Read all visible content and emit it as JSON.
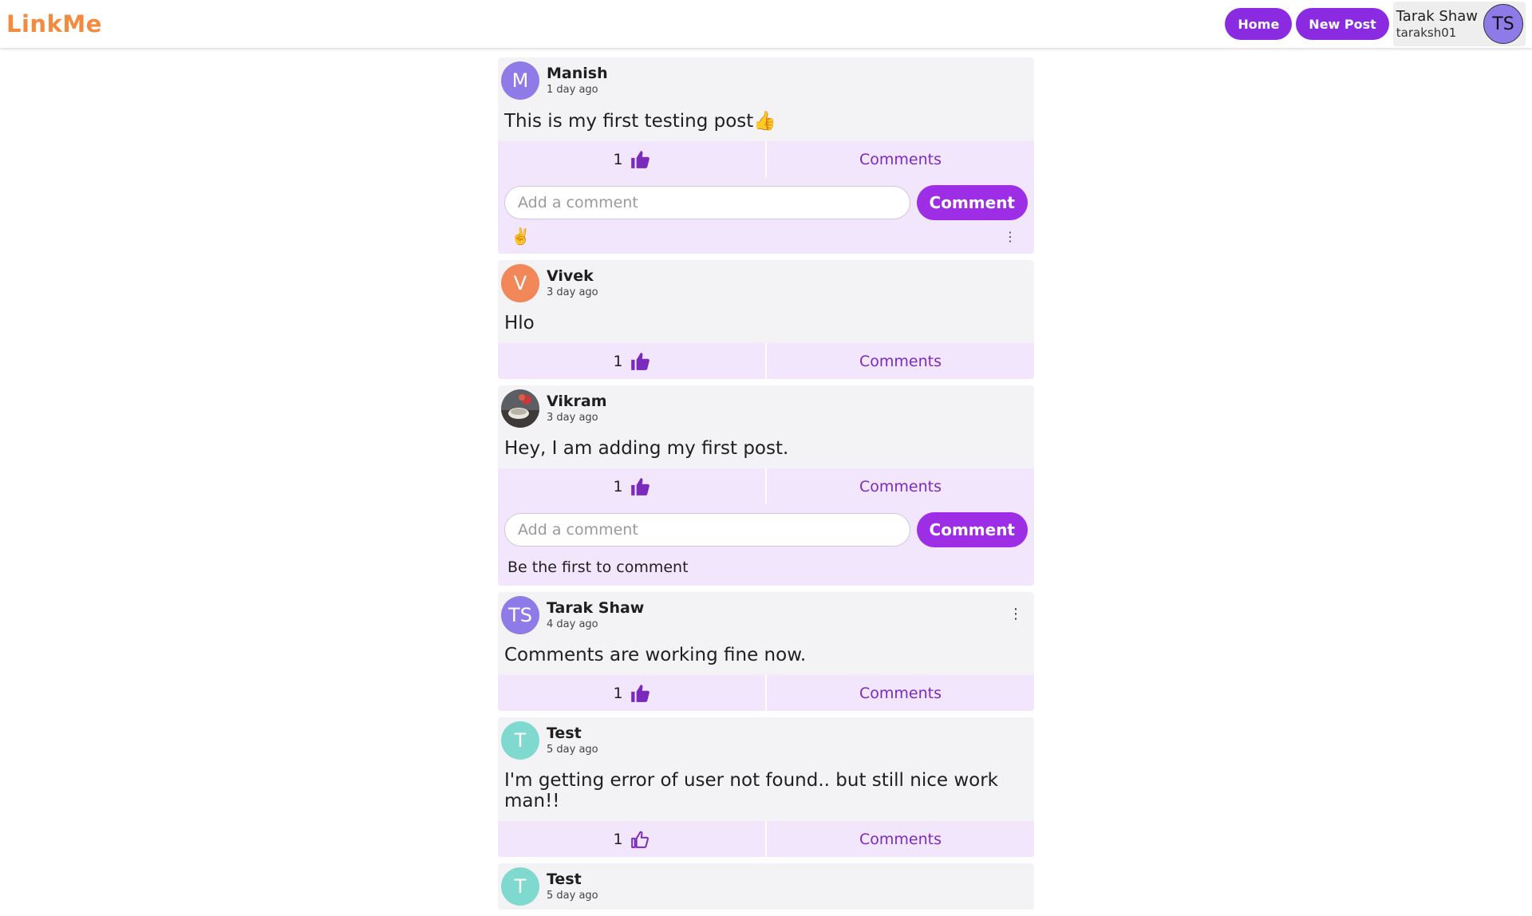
{
  "app": {
    "brand": "LinkMe"
  },
  "nav": {
    "home": "Home",
    "new_post": "New Post",
    "user": {
      "name": "Tarak Shaw",
      "handle": "taraksh01",
      "initials": "TS"
    }
  },
  "colors": {
    "accent": "#8a2be2",
    "brand": "#f28b3f",
    "action_bg": "#f1e6fc"
  },
  "comment_form": {
    "placeholder": "Add a comment",
    "button": "Comment"
  },
  "posts": [
    {
      "author": "Manish",
      "initials": "M",
      "avatar_color": "#8f7be8",
      "time": "1 day ago",
      "text": "This is my first testing post👍",
      "likes": "1",
      "liked": true,
      "comments_label": "Comments",
      "comment_open": true,
      "comments": [
        {
          "text": "✌️"
        }
      ]
    },
    {
      "author": "Vivek",
      "initials": "V",
      "avatar_color": "#f2875a",
      "time": "3 day ago",
      "text": "Hlo",
      "likes": "1",
      "liked": true,
      "comments_label": "Comments"
    },
    {
      "author": "Vikram",
      "initials": "",
      "avatar_color": "#6b5a4e",
      "avatar_photo": true,
      "time": "3 day ago",
      "text": "Hey, I am adding my first post.",
      "likes": "1",
      "liked": true,
      "comments_label": "Comments",
      "comment_open": true,
      "empty_note": "Be the first to comment"
    },
    {
      "author": "Tarak Shaw",
      "initials": "TS",
      "avatar_color": "#8f7be8",
      "time": "4 day ago",
      "text": "Comments are working fine now.",
      "likes": "1",
      "liked": true,
      "comments_label": "Comments",
      "own": true
    },
    {
      "author": "Test",
      "initials": "T",
      "avatar_color": "#7fd9cf",
      "time": "5 day ago",
      "text": "I'm getting error of user not found.. but still nice work man!!",
      "likes": "1",
      "liked": false,
      "comments_label": "Comments"
    },
    {
      "author": "Test",
      "initials": "T",
      "avatar_color": "#7fd9cf",
      "time": "5 day ago"
    }
  ]
}
